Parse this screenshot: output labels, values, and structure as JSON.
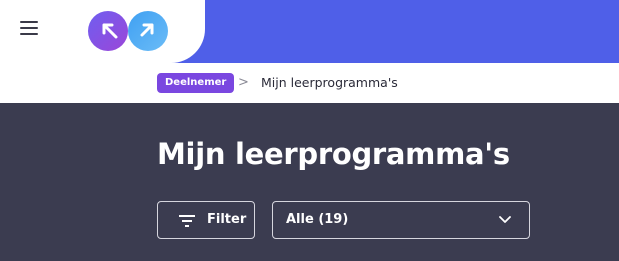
{
  "header": {
    "menu_icon": "hamburger-menu-icon",
    "logo_icon": "infinity-logo-icon",
    "colors": {
      "accent": "#4f5fe8",
      "logo_purple": "#7a47e0",
      "logo_blue": "#5aa8f0"
    }
  },
  "breadcrumb": {
    "badge": "Deelnemer",
    "separator": ">",
    "current": "Mijn leerprogramma's",
    "badge_color": "#7a47e0"
  },
  "main": {
    "title": "Mijn leerprogramma's",
    "filter_button": {
      "label": "Filter",
      "icon": "filter-lines-icon"
    },
    "select": {
      "value": "Alle (19)",
      "icon": "chevron-down-icon"
    },
    "background": "#3b3c50"
  }
}
